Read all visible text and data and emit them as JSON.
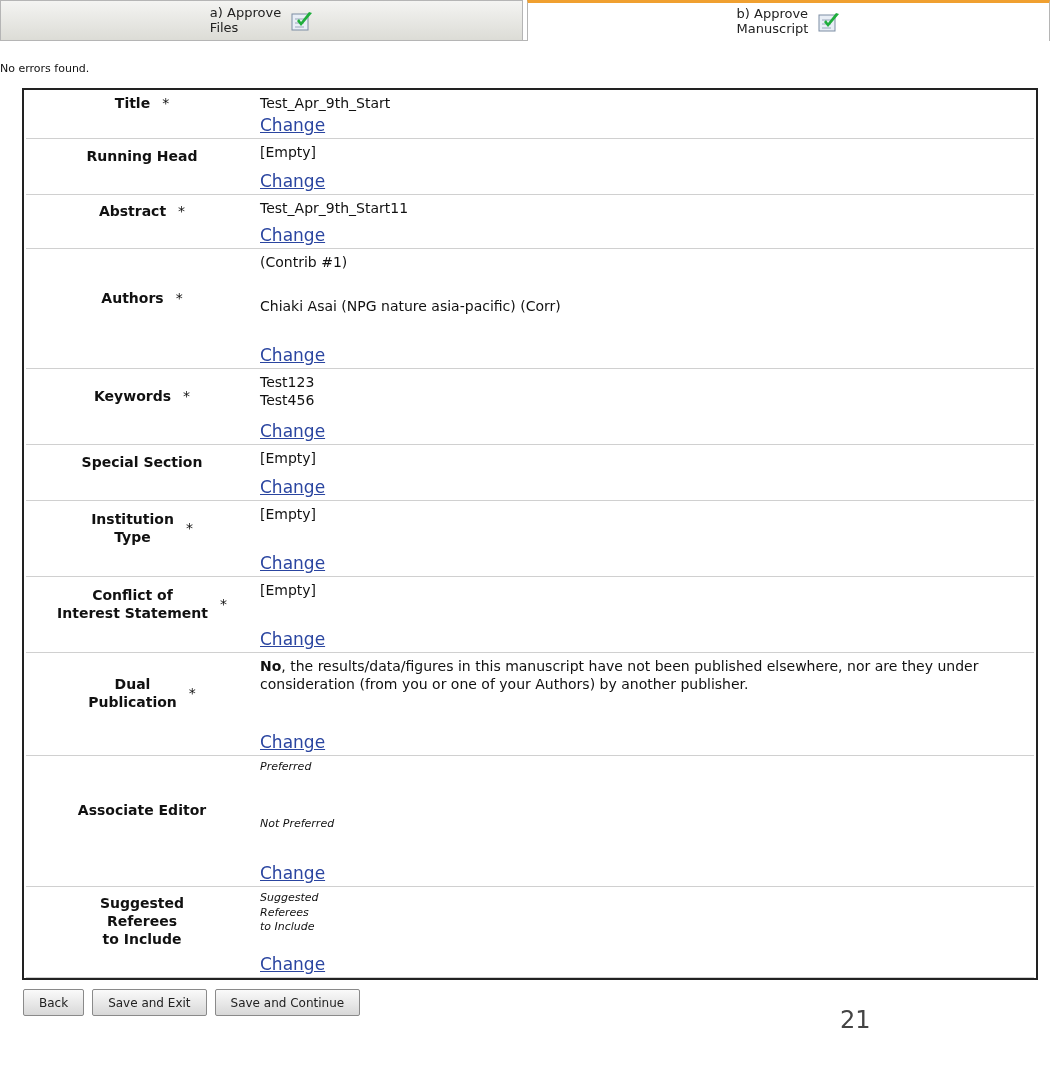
{
  "tabs": [
    {
      "label": "a) Approve\nFiles",
      "selected": false
    },
    {
      "label": "b) Approve\nManuscript",
      "selected": true
    }
  ],
  "message": "No errors found.",
  "fields": [
    {
      "label": "Title",
      "mark": "*",
      "lines": [
        {
          "kind": "text",
          "text": "Test_Apr_9th_Start"
        }
      ],
      "link": "Change"
    },
    {
      "label": "Running Head",
      "lines": [
        {
          "kind": "text",
          "text": "[Empty]"
        }
      ],
      "link": "Change"
    },
    {
      "label": "Abstract",
      "mark": "*",
      "lines": [
        {
          "kind": "text",
          "text": "Test_Apr_9th_Start11"
        }
      ],
      "link": "Change"
    },
    {
      "label": "Authors",
      "mark": "*",
      "lines": [
        {
          "kind": "text",
          "text": "(Contrib #1)"
        },
        {
          "kind": "text",
          "text": "Chiaki Asai (NPG nature asia-pacific) (Corr)"
        }
      ],
      "link": "Change"
    },
    {
      "label": "Keywords",
      "mark": "*",
      "lines": [
        {
          "kind": "text",
          "text": "Test123"
        },
        {
          "kind": "text",
          "text": "Test456"
        }
      ],
      "link": "Change"
    },
    {
      "label": "Special Section",
      "lines": [
        {
          "kind": "text",
          "text": "[Empty]"
        }
      ],
      "link": "Change"
    },
    {
      "label": "Institution\nType",
      "mark": "*",
      "lines": [
        {
          "kind": "text",
          "text": "[Empty]"
        }
      ],
      "link": "Change"
    },
    {
      "label": "Conflict of\nInterest Statement",
      "mark": "*",
      "lines": [
        {
          "kind": "text",
          "text": "[Empty]"
        }
      ],
      "link": "Change"
    },
    {
      "label": "Dual\nPublication",
      "mark": "*",
      "lines": [
        {
          "kind": "text",
          "text": "**No**, the results/data/figures in this manuscript have not been published elsewhere, nor are they under consideration (from you or one of your Authors) by another publisher."
        }
      ],
      "link": "Change"
    },
    {
      "label": "Associate Editor",
      "lines": [
        {
          "kind": "note",
          "text": "Preferred"
        },
        {
          "kind": "note",
          "text": "Not Preferred"
        }
      ],
      "link": "Change"
    },
    {
      "label": "Suggested\nReferees\nto Include",
      "lines": [
        {
          "kind": "note",
          "text": "Suggested\nReferees\nto Include"
        }
      ],
      "link": "Change"
    }
  ],
  "buttons": [
    "Back",
    "Save and Exit",
    "Save and Continue"
  ],
  "page_number": "21"
}
